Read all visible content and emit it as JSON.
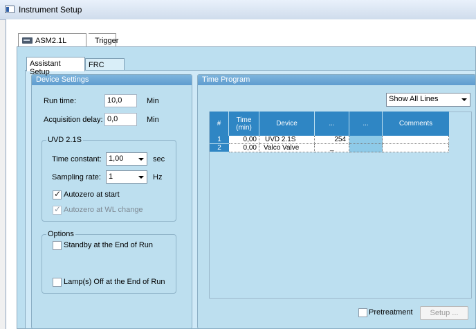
{
  "window": {
    "title": "Instrument Setup"
  },
  "top_tabs": [
    {
      "label": "ASM2.1L"
    },
    {
      "label": "Trigger"
    }
  ],
  "sub_tabs": [
    {
      "label": "Assistant Setup"
    },
    {
      "label": "FRC Setup"
    }
  ],
  "device_settings": {
    "header": "Device Settings",
    "run_time": {
      "label": "Run time:",
      "value": "10,0",
      "unit": "Min"
    },
    "acq_delay": {
      "label": "Acquisition delay:",
      "value": "0,0",
      "unit": "Min"
    },
    "uvd": {
      "legend": "UVD 2.1S",
      "time_constant": {
        "label": "Time constant:",
        "value": "1,00",
        "unit": "sec"
      },
      "sampling_rate": {
        "label": "Sampling rate:",
        "value": "1",
        "unit": "Hz"
      },
      "autozero_start": {
        "label": "Autozero at start",
        "checked": true
      },
      "autozero_wl": {
        "label": "Autozero at WL change",
        "checked": true,
        "disabled": true
      }
    },
    "options": {
      "legend": "Options",
      "standby": {
        "label": "Standby at the End of Run",
        "checked": false
      },
      "lamp_off": {
        "label": "Lamp(s) Off at the End of Run",
        "checked": false
      }
    }
  },
  "time_program": {
    "header": "Time Program",
    "show_lines": "Show All Lines",
    "columns": [
      "#",
      "Time\n(min)",
      "Device",
      "...",
      "...",
      "Comments"
    ],
    "rows": [
      {
        "n": "1",
        "time": "0,00",
        "device": "UVD 2.1S",
        "c4": "254",
        "c5": "",
        "comments": ""
      },
      {
        "n": "2",
        "time": "0,00",
        "device": "Valco Valve",
        "c4": "_",
        "c5": "",
        "comments": ""
      }
    ],
    "pretreatment": {
      "label": "Pretreatment",
      "checked": false
    },
    "setup_button": "Setup ..."
  }
}
